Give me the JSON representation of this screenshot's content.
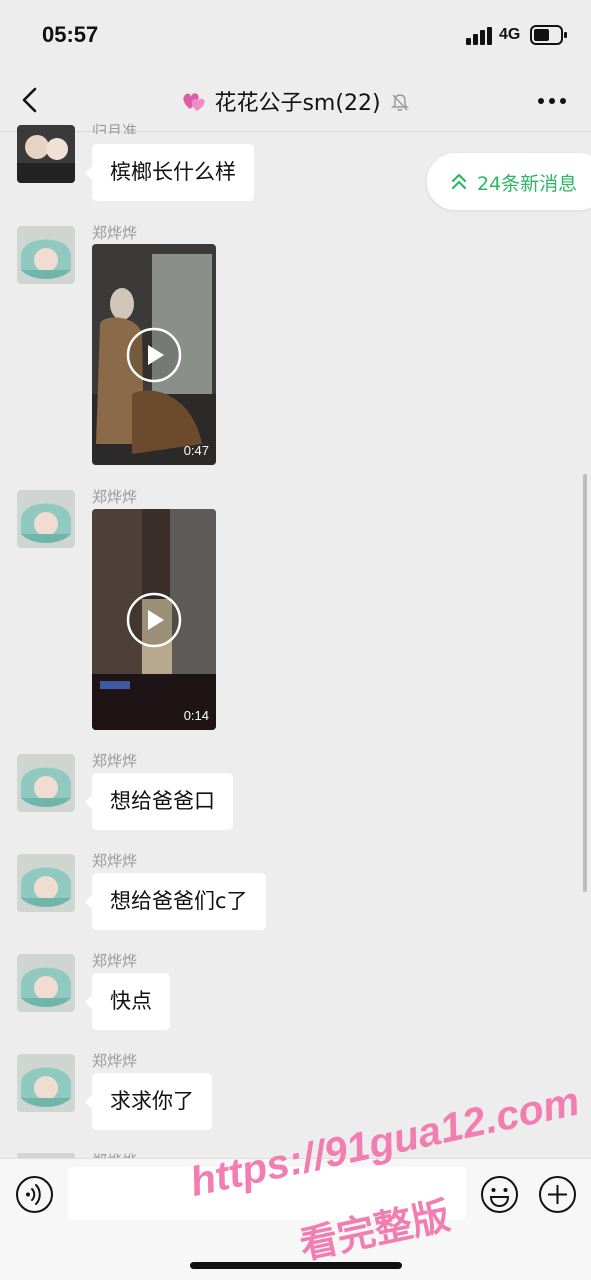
{
  "status_bar": {
    "time": "05:57",
    "network": "4G"
  },
  "header": {
    "title": "花花公子sm(22)"
  },
  "new_messages": {
    "label": "24条新消息"
  },
  "messages": [
    {
      "sender": "归月准",
      "type": "text",
      "text": "槟榔长什么样"
    },
    {
      "sender": "郑烨烨",
      "type": "video",
      "duration": "0:47"
    },
    {
      "sender": "郑烨烨",
      "type": "video",
      "duration": "0:14"
    },
    {
      "sender": "郑烨烨",
      "type": "text",
      "text": "想给爸爸口"
    },
    {
      "sender": "郑烨烨",
      "type": "text",
      "text": "想给爸爸们c了"
    },
    {
      "sender": "郑烨烨",
      "type": "text",
      "text": "快点"
    },
    {
      "sender": "郑烨烨",
      "type": "text",
      "text": "求求你了"
    },
    {
      "sender": "郑烨烨",
      "type": "partial"
    }
  ],
  "input_bar": {
    "value": ""
  },
  "watermark": {
    "url": "https://91gua12.com",
    "text": "看完整版"
  },
  "colors": {
    "background": "#ededed",
    "bubble": "#ffffff",
    "accent_green": "#2bb765",
    "watermark_pink": "#f27db0"
  },
  "icons": [
    "back-icon",
    "heart-icon",
    "mute-bell-icon",
    "more-icon",
    "double-chevron-up-icon",
    "play-icon",
    "voice-icon",
    "emoji-icon",
    "plus-icon"
  ]
}
